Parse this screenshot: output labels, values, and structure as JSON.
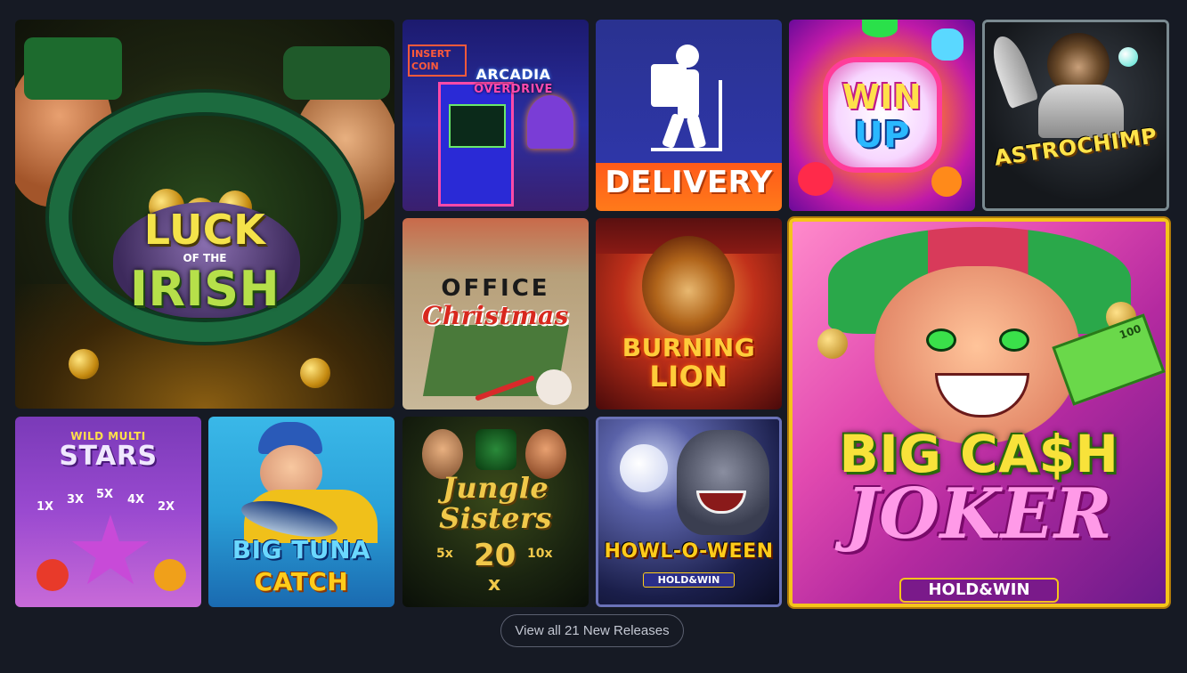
{
  "games": [
    {
      "id": "luck-of-the-irish",
      "title_line1": "LUCK",
      "title_mid": "OF THE",
      "title_line2": "IRISH"
    },
    {
      "id": "arcadia-overdrive",
      "sign": "INSERT COIN",
      "title_line1": "ARCADIA",
      "title_line2": "OVERDRIVE"
    },
    {
      "id": "delivery",
      "title": "DELIVERY"
    },
    {
      "id": "win-up",
      "title_line1": "WIN",
      "title_line2": "UP"
    },
    {
      "id": "astrochimp",
      "title": "ASTROCHIMP"
    },
    {
      "id": "office-christmas",
      "title_line1": "OFFICE",
      "title_line2": "Christmas"
    },
    {
      "id": "burning-lion",
      "title_line1": "BURNING",
      "title_line2": "LION"
    },
    {
      "id": "big-cash-joker",
      "title_line1": "BIG CA$H",
      "title_line2": "JOKER",
      "badge": "HOLD&WIN",
      "note_label": "100"
    },
    {
      "id": "wild-multi-stars",
      "title_top": "WILD MULTI",
      "title": "STARS",
      "multipliers": [
        "1X",
        "3X",
        "5X",
        "4X",
        "2X"
      ]
    },
    {
      "id": "big-tuna-catch",
      "title_line1": "BIG TUNA",
      "title_line2": "CATCH"
    },
    {
      "id": "jungle-sisters",
      "title_line1": "Jungle",
      "title_line2": "Sisters",
      "multi_left": "5x",
      "number": "20",
      "multi_right": "10x",
      "multi_bottom": "x"
    },
    {
      "id": "howl-o-ween",
      "title": "HOWL-O-WEEN",
      "badge": "HOLD&WIN"
    }
  ],
  "view_all": {
    "label": "View all 21 New Releases"
  },
  "colors": {
    "background": "#161a24",
    "button_border": "#5b6070",
    "button_text": "#c3c7d2"
  }
}
